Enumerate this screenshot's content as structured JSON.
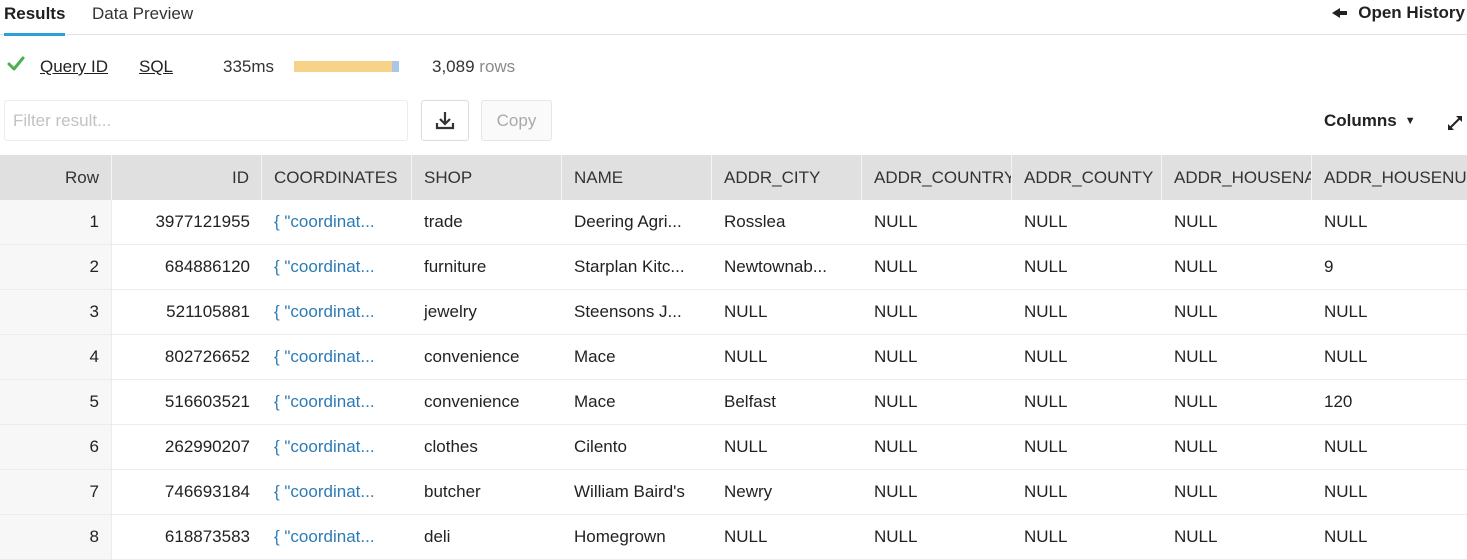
{
  "tabs": {
    "results": "Results",
    "preview": "Data Preview"
  },
  "open_history": "Open History",
  "status": {
    "query_id": "Query ID",
    "sql": "SQL",
    "time": "335ms",
    "progress": 0.93,
    "rows_count": "3,089",
    "rows_unit": "rows"
  },
  "toolbar": {
    "filter_placeholder": "Filter result...",
    "copy": "Copy",
    "columns": "Columns"
  },
  "columns": [
    "Row",
    "ID",
    "COORDINATES",
    "SHOP",
    "NAME",
    "ADDR_CITY",
    "ADDR_COUNTRY",
    "ADDR_COUNTY",
    "ADDR_HOUSENAME",
    "ADDR_HOUSENUMBER"
  ],
  "rows": [
    [
      "1",
      "3977121955",
      "{ \"coordinat...",
      "trade",
      "Deering Agri...",
      "Rosslea",
      "NULL",
      "NULL",
      "NULL",
      "NULL"
    ],
    [
      "2",
      "684886120",
      "{ \"coordinat...",
      "furniture",
      "Starplan Kitc...",
      "Newtownab...",
      "NULL",
      "NULL",
      "NULL",
      "9"
    ],
    [
      "3",
      "521105881",
      "{ \"coordinat...",
      "jewelry",
      "Steensons J...",
      "NULL",
      "NULL",
      "NULL",
      "NULL",
      "NULL"
    ],
    [
      "4",
      "802726652",
      "{ \"coordinat...",
      "convenience",
      "Mace",
      "NULL",
      "NULL",
      "NULL",
      "NULL",
      "NULL"
    ],
    [
      "5",
      "516603521",
      "{ \"coordinat...",
      "convenience",
      "Mace",
      "Belfast",
      "NULL",
      "NULL",
      "NULL",
      "120"
    ],
    [
      "6",
      "262990207",
      "{ \"coordinat...",
      "clothes",
      "Cilento",
      "NULL",
      "NULL",
      "NULL",
      "NULL",
      "NULL"
    ],
    [
      "7",
      "746693184",
      "{ \"coordinat...",
      "butcher",
      "William Baird's",
      "Newry",
      "NULL",
      "NULL",
      "NULL",
      "NULL"
    ],
    [
      "8",
      "618873583",
      "{ \"coordinat...",
      "deli",
      "Homegrown",
      "NULL",
      "NULL",
      "NULL",
      "NULL",
      "NULL"
    ]
  ],
  "colors": {
    "accent": "#29a0d6",
    "link": "#2c7bb6",
    "success": "#4caf50",
    "progress": "#f7d289"
  }
}
